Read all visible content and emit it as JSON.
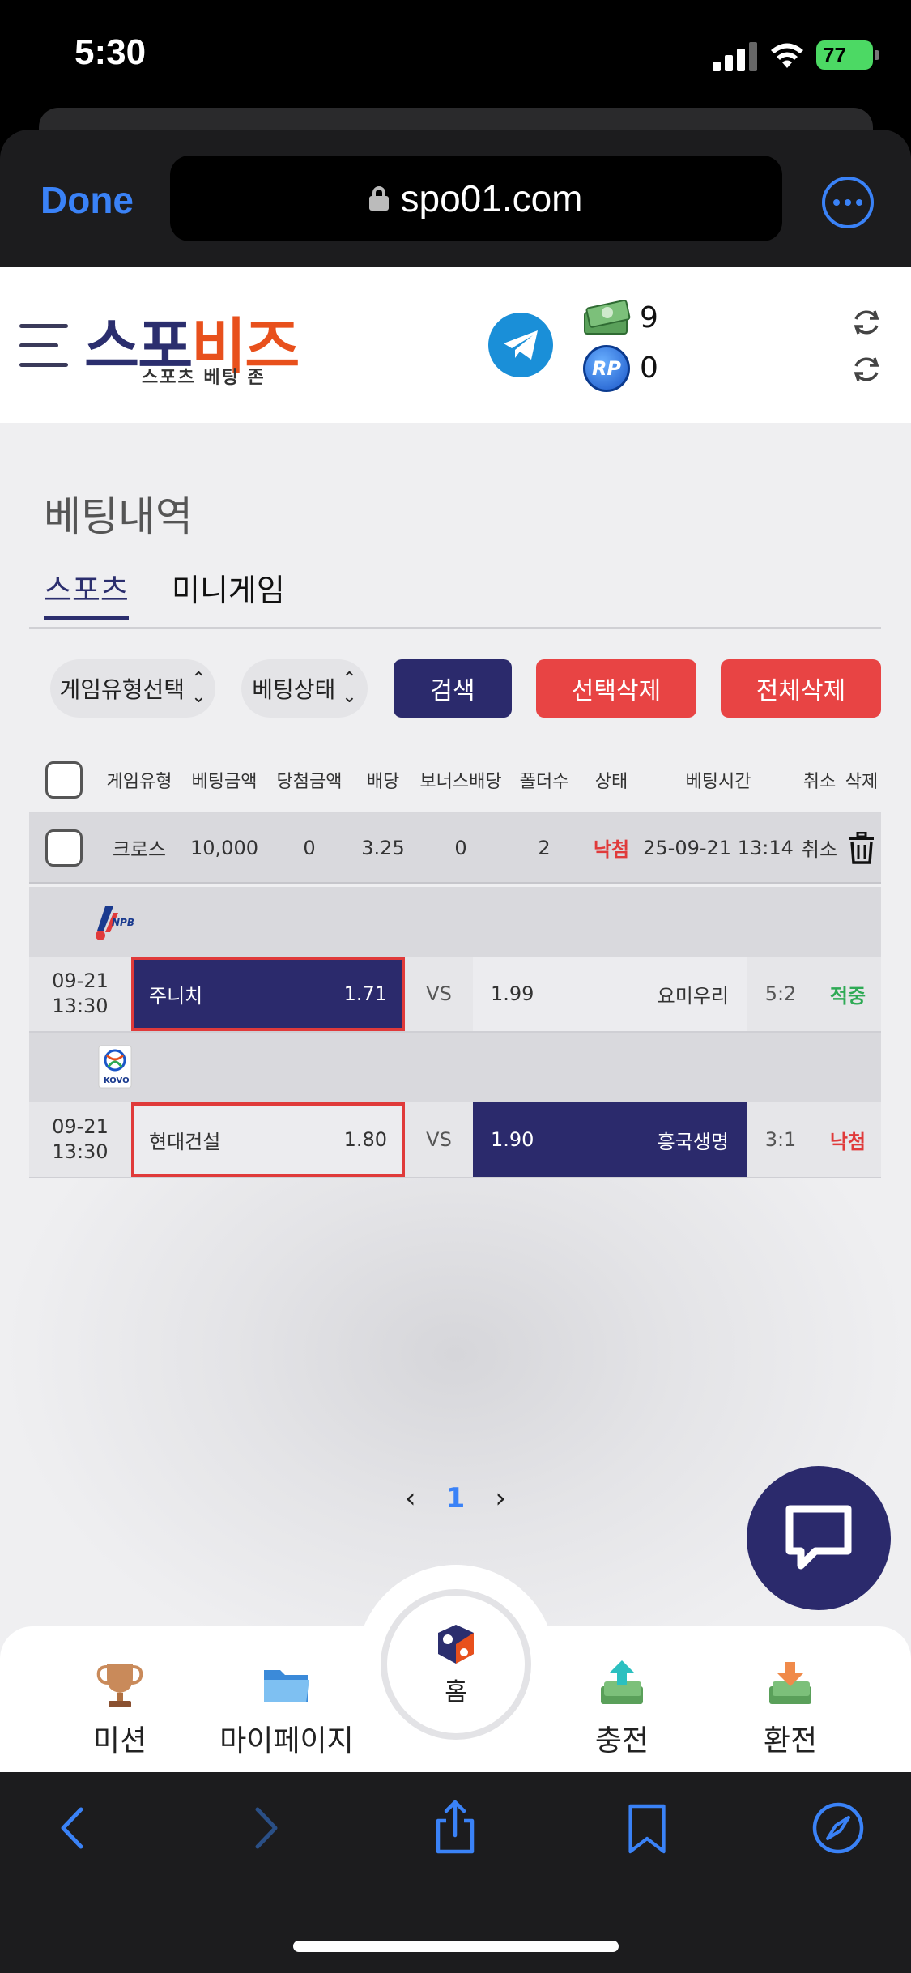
{
  "status_bar": {
    "time": "5:30",
    "battery": "77"
  },
  "browser": {
    "done_label": "Done",
    "url": "spo01.com"
  },
  "site": {
    "logo_part1": "스포",
    "logo_part2": "비즈",
    "logo_subtitle": "스포츠 베팅 존",
    "cash_value": "9",
    "rp_value": "0",
    "rp_icon_label": "RP"
  },
  "page": {
    "title": "베팅내역",
    "tabs": [
      "스포츠",
      "미니게임"
    ],
    "filter_game_type": "게임유형선택",
    "filter_bet_status": "베팅상태",
    "search_label": "검색",
    "delete_selected_label": "선택삭제",
    "delete_all_label": "전체삭제"
  },
  "table": {
    "headers": [
      "게임유형",
      "베팅금액",
      "당첨금액",
      "배당",
      "보너스배당",
      "폴더수",
      "상태",
      "베팅시간",
      "취소",
      "삭제"
    ],
    "bet": {
      "game_type": "크로스",
      "bet_amount": "10,000",
      "win_amount": "0",
      "odds": "3.25",
      "bonus_odds": "0",
      "folders": "2",
      "status": "낙첨",
      "bet_time": "25-09-21 13:14",
      "cancel": "취소"
    },
    "matches": [
      {
        "league": "NPB",
        "date": "09-21",
        "time": "13:30",
        "home": "주니치",
        "home_odds": "1.71",
        "vs": "VS",
        "away_odds": "1.99",
        "away": "요미우리",
        "score": "5:2",
        "result": "적중"
      },
      {
        "league": "KOVO",
        "date": "09-21",
        "time": "13:30",
        "home": "현대건설",
        "home_odds": "1.80",
        "vs": "VS",
        "away_odds": "1.90",
        "away": "흥국생명",
        "score": "3:1",
        "result": "낙첨"
      }
    ]
  },
  "pagination": {
    "current": "1"
  },
  "bottom_nav": {
    "mission": "미션",
    "mypage": "마이페이지",
    "home": "홈",
    "deposit": "충전",
    "withdraw": "환전"
  },
  "colors": {
    "brand_navy": "#2b2a6c",
    "brand_orange": "#e8501c",
    "danger": "#e84444",
    "win": "#2eaa55",
    "ios_blue": "#3a82f7"
  }
}
